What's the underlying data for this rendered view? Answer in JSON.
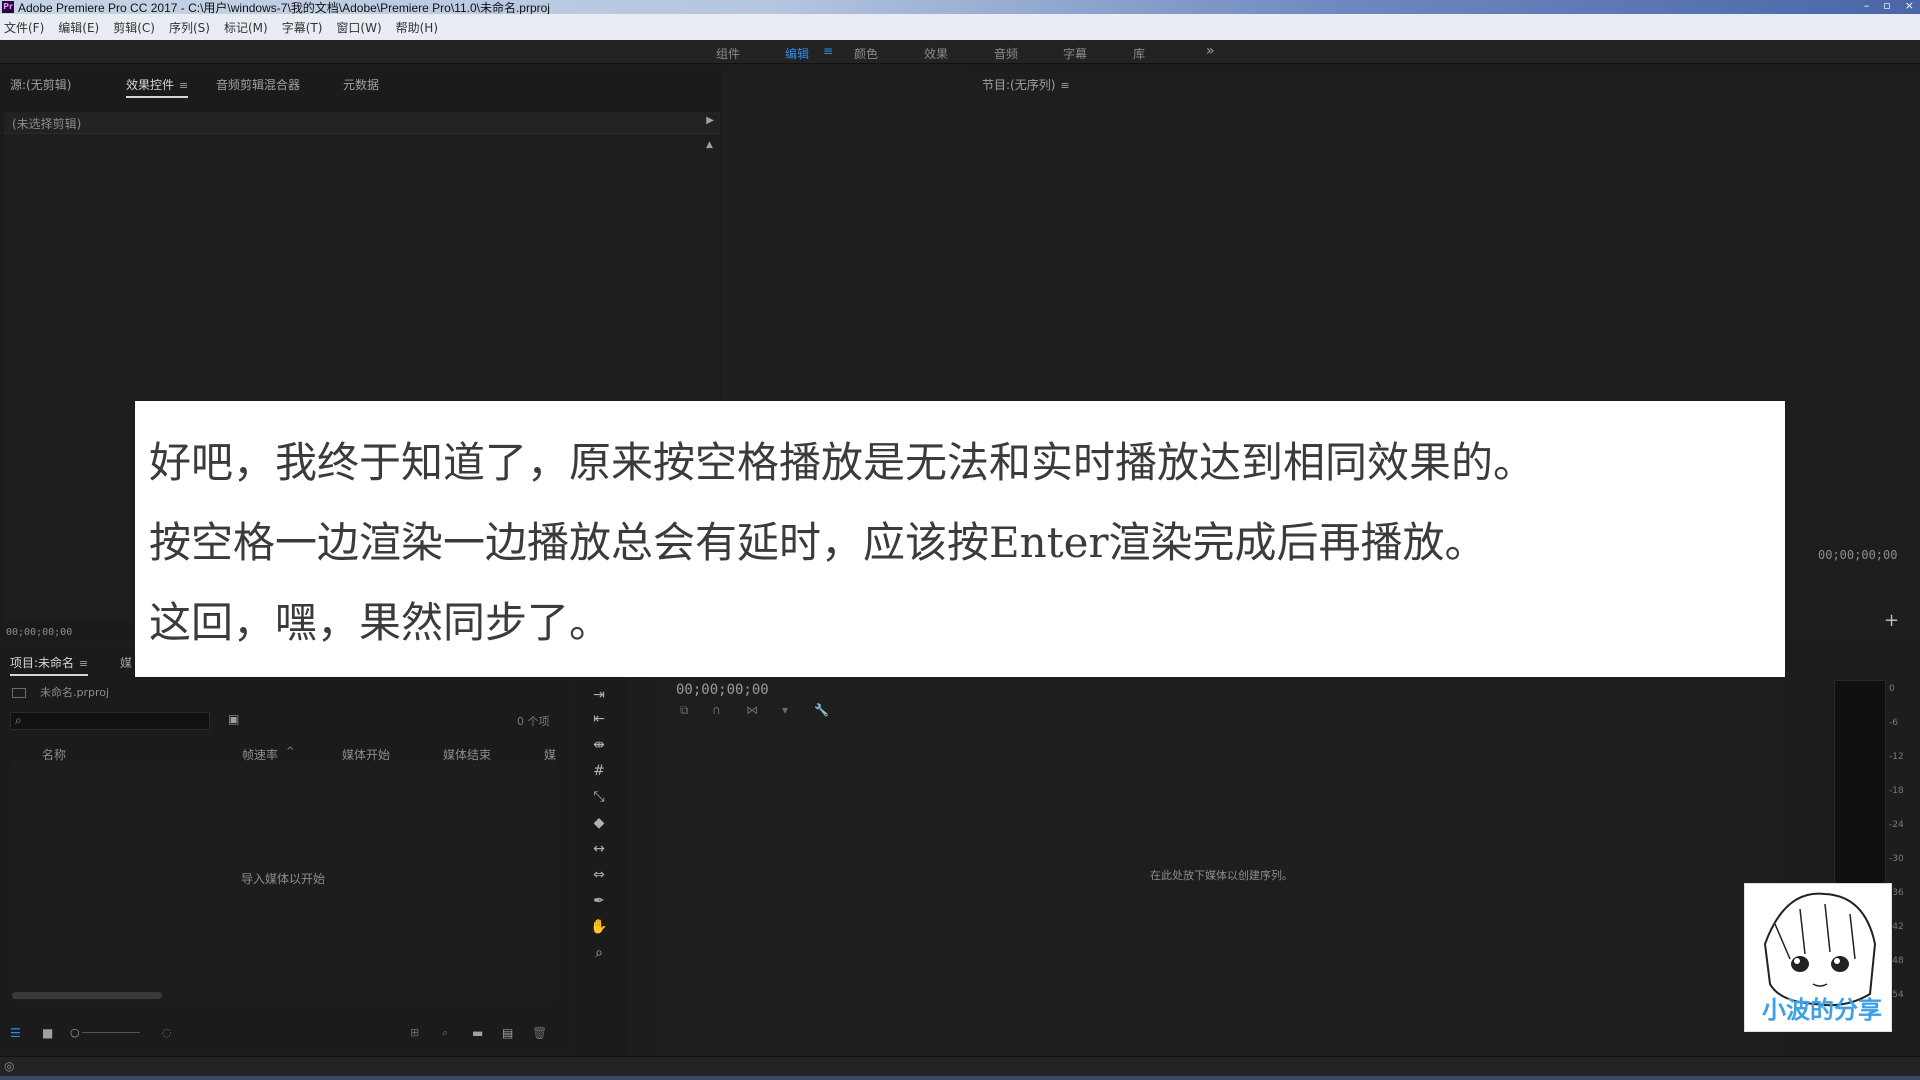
{
  "window": {
    "app_icon": "Pr",
    "title": "Adobe Premiere Pro CC 2017 - C:\\用户\\windows-7\\我的文档\\Adobe\\Premiere Pro\\11.0\\未命名.prproj",
    "controls": [
      "–",
      "▫",
      "×"
    ]
  },
  "menu": [
    "文件(F)",
    "编辑(E)",
    "剪辑(C)",
    "序列(S)",
    "标记(M)",
    "字幕(T)",
    "窗口(W)",
    "帮助(H)"
  ],
  "workspaces": {
    "items": [
      "组件",
      "编辑",
      "颜色",
      "效果",
      "音频",
      "字幕",
      "库"
    ],
    "active_index": 1,
    "menu_glyph": "≡",
    "more": "»"
  },
  "source_panel": {
    "tabs": [
      "源:(无剪辑)",
      "效果控件",
      "音频剪辑混合器",
      "元数据"
    ],
    "active_tab": 1,
    "menu_glyph": "≡",
    "no_clip": "(未选择剪辑)",
    "timecode": "00;00;00;00"
  },
  "program_panel": {
    "title": "节目:(无序列)",
    "menu_glyph": "≡",
    "timecode": "00;00;00;00",
    "add_button": "+"
  },
  "project_panel": {
    "tabs": [
      "项目:未命名",
      "媒"
    ],
    "menu_glyph": "≡",
    "file_name": "未命名.prproj",
    "item_count": "0 个项",
    "columns": [
      "名称",
      "帧速率",
      "媒体开始",
      "媒体结束",
      "媒"
    ],
    "sort_glyph": "^",
    "empty_text": "导入媒体以开始"
  },
  "timeline": {
    "timecode": "00;00;00;00",
    "empty_text": "在此处放下媒体以创建序列。"
  },
  "meter": {
    "ticks": [
      "0",
      "-6",
      "-12",
      "-18",
      "-24",
      "-30",
      "-36",
      "-42",
      "-48",
      "-54"
    ]
  },
  "overlay": {
    "lines": [
      "好吧，我终于知道了，原来按空格播放是无法和实时播放达到相同效果的。",
      "按空格一边渲染一边播放总会有延时，应该按Enter渲染完成后再播放。",
      "这回，嘿，果然同步了。"
    ]
  },
  "watermark": {
    "text": "小波的分享"
  }
}
